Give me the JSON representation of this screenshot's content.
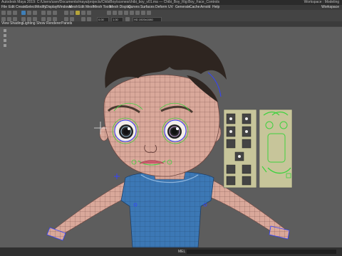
{
  "window": {
    "title": "Autodesk Maya 2019: C:/Users/user/Documents/maya/projects/ChibiBoy/scenes/chibi_boy_v01.ma — Chibi_Boy_Rig:Boy_Face_Controls",
    "right_label": "Workspace : Modeling"
  },
  "menus": [
    "File",
    "Edit",
    "Create",
    "Select",
    "Modify",
    "Display",
    "Windows",
    "Mesh",
    "Edit Mesh",
    "Mesh Tools",
    "Mesh Display",
    "Curves",
    "Surfaces",
    "Deform",
    "UV",
    "Generate",
    "Cache",
    "Arnold",
    "Help"
  ],
  "menu_right": "Workspace",
  "shelf": {
    "field1": "0.00",
    "field2": "1.00",
    "resolution": "HD 1920x1080"
  },
  "panel_menus": [
    "View",
    "Shading",
    "Lighting",
    "Show",
    "Renderer",
    "Panels"
  ],
  "status": {
    "mel_label": "MEL"
  },
  "colors": {
    "viewport_bg": "#5d5d5d",
    "wire": "#d9a89a",
    "wire_line": "#7a4f4a",
    "shirt": "#3c78b5",
    "hair": "#2e2520",
    "face_ctrl_panel": "#c7c59a",
    "control_green": "#3fd13f",
    "selection_blue": "#3344ff"
  }
}
